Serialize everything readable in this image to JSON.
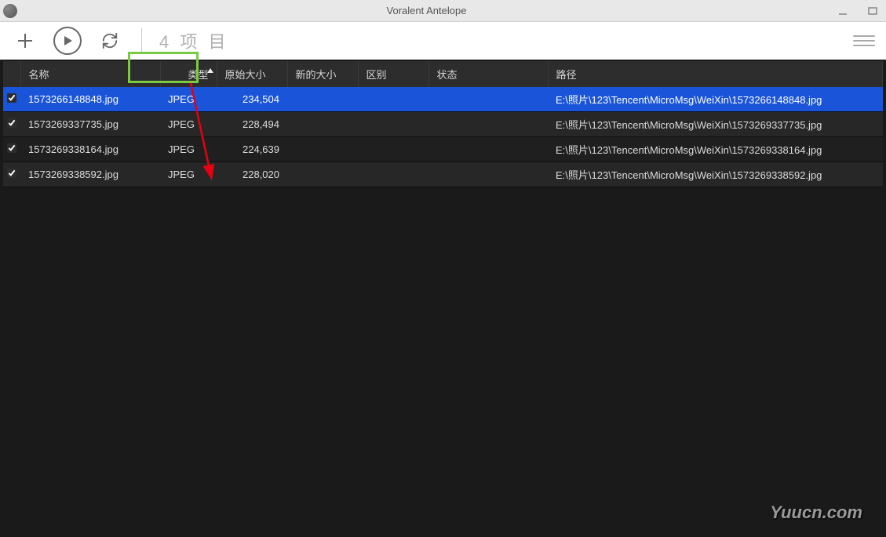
{
  "window": {
    "title": "Voralent Antelope"
  },
  "toolbar": {
    "count_label": "4 项 目"
  },
  "columns": {
    "name": "名称",
    "type": "类型",
    "original_size": "原始大小",
    "new_size": "新的大小",
    "diff": "区别",
    "status": "状态",
    "path": "路径"
  },
  "rows": [
    {
      "checked": true,
      "selected": true,
      "name": "1573266148848.jpg",
      "type": "JPEG",
      "original_size": "234,504",
      "new_size": "",
      "diff": "",
      "status": "",
      "path": "E:\\照片\\123\\Tencent\\MicroMsg\\WeiXin\\1573266148848.jpg"
    },
    {
      "checked": true,
      "selected": false,
      "name": "1573269337735.jpg",
      "type": "JPEG",
      "original_size": "228,494",
      "new_size": "",
      "diff": "",
      "status": "",
      "path": "E:\\照片\\123\\Tencent\\MicroMsg\\WeiXin\\1573269337735.jpg"
    },
    {
      "checked": true,
      "selected": false,
      "name": "1573269338164.jpg",
      "type": "JPEG",
      "original_size": "224,639",
      "new_size": "",
      "diff": "",
      "status": "",
      "path": "E:\\照片\\123\\Tencent\\MicroMsg\\WeiXin\\1573269338164.jpg"
    },
    {
      "checked": true,
      "selected": false,
      "name": "1573269338592.jpg",
      "type": "JPEG",
      "original_size": "228,020",
      "new_size": "",
      "diff": "",
      "status": "",
      "path": "E:\\照片\\123\\Tencent\\MicroMsg\\WeiXin\\1573269338592.jpg"
    }
  ],
  "watermark": "Yuucn.com"
}
